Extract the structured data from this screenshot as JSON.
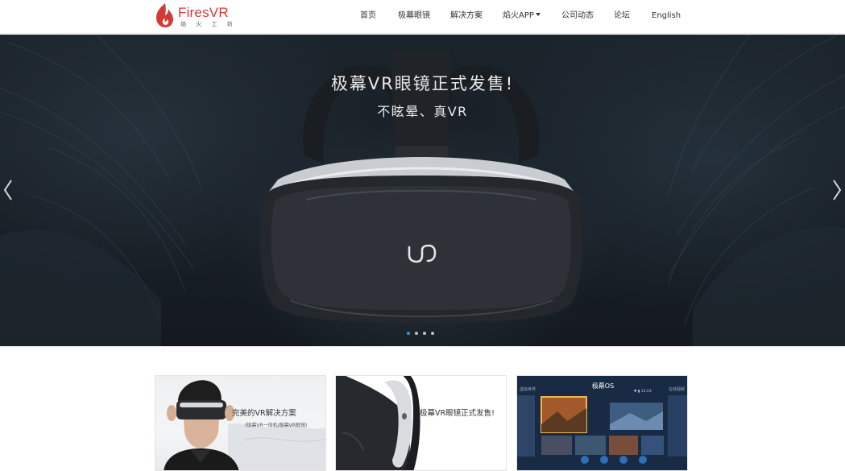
{
  "header": {
    "logo": {
      "name": "FiresVR",
      "subtitle": "焰 火 工 坊"
    },
    "nav": [
      {
        "label": "首页"
      },
      {
        "label": "极幕眼镜"
      },
      {
        "label": "解决方案"
      },
      {
        "label": "焰火APP",
        "has_dropdown": true
      },
      {
        "label": "公司动态"
      },
      {
        "label": "论坛"
      },
      {
        "label": "English"
      }
    ]
  },
  "banner": {
    "title": "极幕VR眼镜正式发售!",
    "subtitle": "不眩晕、真VR",
    "slide_count": 4,
    "active_slide": 1
  },
  "cards": [
    {
      "title": "完美的VR解决方案",
      "subtitle": "(极幕VR一体机/极幕VR眼镜)"
    },
    {
      "title": "极幕VR眼镜正式发售!"
    },
    {
      "title": "极幕OS",
      "left_label": "虚拟世界",
      "right_label": "在线视频",
      "status": "▼ ▮ 13:23"
    }
  ],
  "colors": {
    "brand": "#d33b36",
    "dot_active": "#3f8fd8",
    "dot_inactive": "#bfbfbf"
  },
  "icons": {
    "logo": "flame-logo-icon",
    "prev": "chevron-left-icon",
    "next": "chevron-right-icon",
    "dropdown": "caret-down-icon"
  }
}
